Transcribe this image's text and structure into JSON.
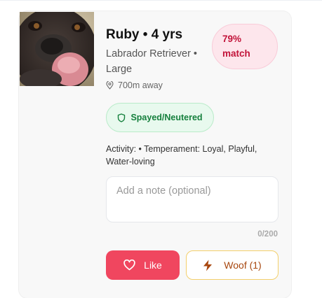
{
  "profile": {
    "name_age": "Ruby • 4 yrs",
    "breed_size": "Labrador Retriever • Large",
    "distance": "700m away",
    "match_percent": "79%",
    "match_label": "match",
    "status_badge": "Spayed/Neutered",
    "description": "Activity: • Temperament: Loyal, Playful, Water-loving"
  },
  "note": {
    "placeholder": "Add a note (optional)",
    "value": "",
    "char_count": "0/200"
  },
  "actions": {
    "like_label": "Like",
    "woof_label": "Woof (1)"
  },
  "colors": {
    "like_bg": "#f0465f",
    "match_text": "#c2143a",
    "badge_text": "#15803d",
    "woof_text": "#a8470f"
  },
  "icons": [
    "map-pin-icon",
    "shield-icon",
    "heart-icon",
    "lightning-icon"
  ]
}
